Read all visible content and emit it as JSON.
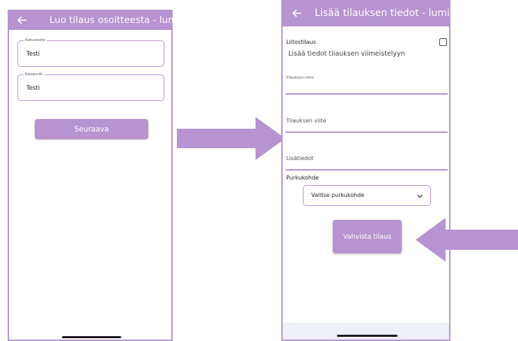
{
  "colors": {
    "accent": "#b793cf",
    "text": "#1c1b1f"
  },
  "left_screen": {
    "appbar": {
      "back_icon": "arrow-left-icon",
      "title": "Luo tilaus osoitteesta - lumi"
    },
    "street_field": {
      "label": "Katuosoite",
      "value": "Testi"
    },
    "city_field": {
      "label": "Kaupunki",
      "value": "Testi"
    },
    "next_button": "Seuraava"
  },
  "right_screen": {
    "appbar": {
      "back_icon": "arrow-left-icon",
      "title": "Lisää tilauksen tiedot - lumi"
    },
    "attached_order_label": "Liitostilaus",
    "info_text": "Lisää tiedot tilauksen viimeistelyyn",
    "order_name_label": "Tilauksen nimi",
    "order_reference_label": "Tilauksen viite",
    "additional_info_label": "Lisätiedot",
    "demolition_site_label": "Purkukohde",
    "demolition_site_select": {
      "value": "Valitse purkukohde",
      "icon": "chevron-down-icon"
    },
    "confirm_button": "Vahvista tilaus"
  }
}
